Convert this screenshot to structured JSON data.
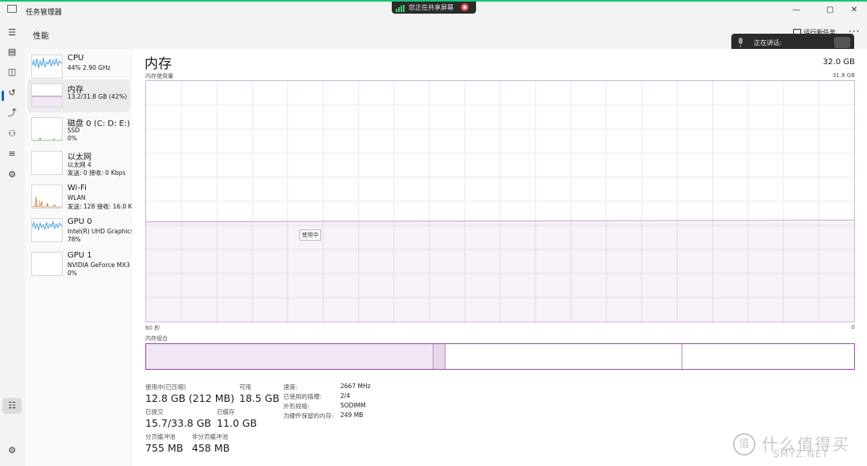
{
  "window": {
    "title": "任务管理器",
    "controls": {
      "minimize": "—",
      "maximize": "▢",
      "close": "✕"
    }
  },
  "screen_share": {
    "text": "您正在共享屏幕",
    "status_color": "#3ed06c",
    "stop_color": "#e04848"
  },
  "voice_banner": {
    "text": "正在讲话:"
  },
  "header": {
    "title": "性能",
    "run_task": "运行新任务",
    "more": "···"
  },
  "rail": {
    "items": [
      "hamburger-icon",
      "processes-icon",
      "performance-icon",
      "history-icon",
      "startup-icon",
      "users-icon",
      "details-icon",
      "services-icon",
      "settings-icon"
    ],
    "active_index": 2
  },
  "perf_list": [
    {
      "title": "CPU",
      "lines": [
        "44% 2.90 GHz"
      ],
      "graph_color": "#3a96dd"
    },
    {
      "title": "内存",
      "lines": [
        "13.2/31.8 GB (42%)"
      ],
      "graph_color": "#9b4aa7"
    },
    {
      "title": "磁盘 0 (C: D: E:)",
      "lines": [
        "SSD",
        "0%"
      ],
      "graph_color": "#4caf50"
    },
    {
      "title": "以太网",
      "lines": [
        "以太网 4",
        "发送: 0 接收: 0 Kbps"
      ],
      "graph_color": "#c48a3a"
    },
    {
      "title": "Wi-Fi",
      "lines": [
        "WLAN",
        "发送: 128 接收: 16.0 K"
      ],
      "graph_color": "#c48a3a"
    },
    {
      "title": "GPU 0",
      "lines": [
        "Intel(R) UHD Graphics",
        "78%"
      ],
      "graph_color": "#3a96dd"
    },
    {
      "title": "GPU 1",
      "lines": [
        "NVIDIA GeForce MX3",
        "0%"
      ],
      "graph_color": "#3a96dd"
    }
  ],
  "memory": {
    "heading": "内存",
    "total": "32.0 GB",
    "usage_label": "内存使用量",
    "usage_max": "31.8 GB",
    "usage_fraction": 0.415,
    "graph_tooltip": "使用中",
    "axis_left": "60 秒",
    "axis_right": "0",
    "composition_label": "内存组合",
    "composition": {
      "in_use_fraction": 0.405,
      "modified_fraction": 0.016,
      "standby_fraction": 0.334
    },
    "accent_color": "#9b4aa7"
  },
  "stats": {
    "in_use_label": "使用中(已压缩)",
    "in_use_value": "12.8 GB (212 MB)",
    "available_label": "可用",
    "available_value": "18.5 GB",
    "committed_label": "已提交",
    "committed_value": "15.7/33.8 GB",
    "cached_label": "已缓存",
    "cached_value": "11.0 GB",
    "paged_label": "分页缓冲池",
    "paged_value": "755 MB",
    "nonpaged_label": "非分页缓冲池",
    "nonpaged_value": "458 MB"
  },
  "specs": [
    {
      "key": "速度:",
      "value": "2667 MHz"
    },
    {
      "key": "已使用的插槽:",
      "value": "2/4"
    },
    {
      "key": "外形规格:",
      "value": "SODIMM"
    },
    {
      "key": "为硬件保留的内存:",
      "value": "249 MB"
    }
  ],
  "watermark": {
    "badge": "值",
    "text": "什么值得买",
    "site": "SMYZ.NET"
  }
}
